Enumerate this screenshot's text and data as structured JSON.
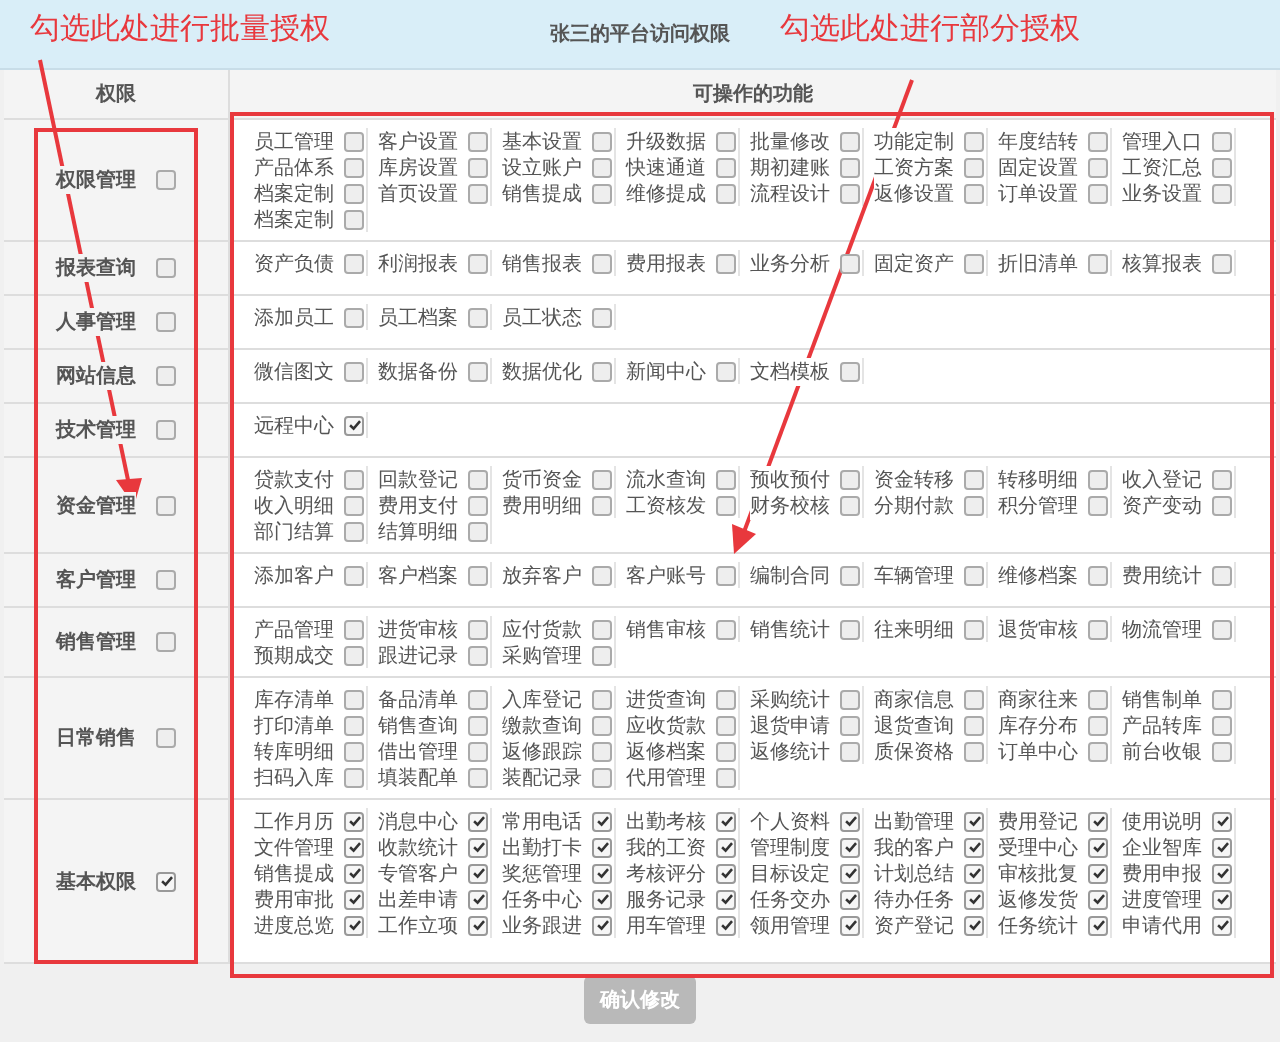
{
  "title": "张三的平台访问权限",
  "columns": [
    "权限",
    "可操作的功能"
  ],
  "annotations": [
    "勾选此处进行批量授权",
    "勾选此处进行部分授权"
  ],
  "groups": [
    {
      "name": "权限管理",
      "checked": false,
      "items": [
        {
          "label": "员工管理",
          "checked": false
        },
        {
          "label": "客户设置",
          "checked": false
        },
        {
          "label": "基本设置",
          "checked": false
        },
        {
          "label": "升级数据",
          "checked": false
        },
        {
          "label": "批量修改",
          "checked": false
        },
        {
          "label": "功能定制",
          "checked": false
        },
        {
          "label": "年度结转",
          "checked": false
        },
        {
          "label": "管理入口",
          "checked": false
        },
        {
          "label": "产品体系",
          "checked": false
        },
        {
          "label": "库房设置",
          "checked": false
        },
        {
          "label": "设立账户",
          "checked": false
        },
        {
          "label": "快速通道",
          "checked": false
        },
        {
          "label": "期初建账",
          "checked": false
        },
        {
          "label": "工资方案",
          "checked": false
        },
        {
          "label": "固定设置",
          "checked": false
        },
        {
          "label": "工资汇总",
          "checked": false
        },
        {
          "label": "档案定制",
          "checked": false
        },
        {
          "label": "首页设置",
          "checked": false
        },
        {
          "label": "销售提成",
          "checked": false
        },
        {
          "label": "维修提成",
          "checked": false
        },
        {
          "label": "流程设计",
          "checked": false
        },
        {
          "label": "返修设置",
          "checked": false
        },
        {
          "label": "订单设置",
          "checked": false
        },
        {
          "label": "业务设置",
          "checked": false
        },
        {
          "label": "档案定制",
          "checked": false
        }
      ]
    },
    {
      "name": "报表查询",
      "checked": false,
      "items": [
        {
          "label": "资产负债",
          "checked": false
        },
        {
          "label": "利润报表",
          "checked": false
        },
        {
          "label": "销售报表",
          "checked": false
        },
        {
          "label": "费用报表",
          "checked": false
        },
        {
          "label": "业务分析",
          "checked": false
        },
        {
          "label": "固定资产",
          "checked": false
        },
        {
          "label": "折旧清单",
          "checked": false
        },
        {
          "label": "核算报表",
          "checked": false
        }
      ]
    },
    {
      "name": "人事管理",
      "checked": false,
      "items": [
        {
          "label": "添加员工",
          "checked": false
        },
        {
          "label": "员工档案",
          "checked": false
        },
        {
          "label": "员工状态",
          "checked": false
        }
      ]
    },
    {
      "name": "网站信息",
      "checked": false,
      "items": [
        {
          "label": "微信图文",
          "checked": false
        },
        {
          "label": "数据备份",
          "checked": false
        },
        {
          "label": "数据优化",
          "checked": false
        },
        {
          "label": "新闻中心",
          "checked": false
        },
        {
          "label": "文档模板",
          "checked": false
        }
      ]
    },
    {
      "name": "技术管理",
      "checked": false,
      "items": [
        {
          "label": "远程中心",
          "checked": true
        }
      ]
    },
    {
      "name": "资金管理",
      "checked": false,
      "items": [
        {
          "label": "贷款支付",
          "checked": false
        },
        {
          "label": "回款登记",
          "checked": false
        },
        {
          "label": "货币资金",
          "checked": false
        },
        {
          "label": "流水查询",
          "checked": false
        },
        {
          "label": "预收预付",
          "checked": false
        },
        {
          "label": "资金转移",
          "checked": false
        },
        {
          "label": "转移明细",
          "checked": false
        },
        {
          "label": "收入登记",
          "checked": false
        },
        {
          "label": "收入明细",
          "checked": false
        },
        {
          "label": "费用支付",
          "checked": false
        },
        {
          "label": "费用明细",
          "checked": false
        },
        {
          "label": "工资核发",
          "checked": false
        },
        {
          "label": "财务校核",
          "checked": false
        },
        {
          "label": "分期付款",
          "checked": false
        },
        {
          "label": "积分管理",
          "checked": false
        },
        {
          "label": "资产变动",
          "checked": false
        },
        {
          "label": "部门结算",
          "checked": false
        },
        {
          "label": "结算明细",
          "checked": false
        }
      ]
    },
    {
      "name": "客户管理",
      "checked": false,
      "items": [
        {
          "label": "添加客户",
          "checked": false
        },
        {
          "label": "客户档案",
          "checked": false
        },
        {
          "label": "放弃客户",
          "checked": false
        },
        {
          "label": "客户账号",
          "checked": false
        },
        {
          "label": "编制合同",
          "checked": false
        },
        {
          "label": "车辆管理",
          "checked": false
        },
        {
          "label": "维修档案",
          "checked": false
        },
        {
          "label": "费用统计",
          "checked": false
        }
      ]
    },
    {
      "name": "销售管理",
      "checked": false,
      "items": [
        {
          "label": "产品管理",
          "checked": false
        },
        {
          "label": "进货审核",
          "checked": false
        },
        {
          "label": "应付货款",
          "checked": false
        },
        {
          "label": "销售审核",
          "checked": false
        },
        {
          "label": "销售统计",
          "checked": false
        },
        {
          "label": "往来明细",
          "checked": false
        },
        {
          "label": "退货审核",
          "checked": false
        },
        {
          "label": "物流管理",
          "checked": false
        },
        {
          "label": "预期成交",
          "checked": false
        },
        {
          "label": "跟进记录",
          "checked": false
        },
        {
          "label": "采购管理",
          "checked": false
        }
      ]
    },
    {
      "name": "日常销售",
      "checked": false,
      "items": [
        {
          "label": "库存清单",
          "checked": false
        },
        {
          "label": "备品清单",
          "checked": false
        },
        {
          "label": "入库登记",
          "checked": false
        },
        {
          "label": "进货查询",
          "checked": false
        },
        {
          "label": "采购统计",
          "checked": false
        },
        {
          "label": "商家信息",
          "checked": false
        },
        {
          "label": "商家往来",
          "checked": false
        },
        {
          "label": "销售制单",
          "checked": false
        },
        {
          "label": "打印清单",
          "checked": false
        },
        {
          "label": "销售查询",
          "checked": false
        },
        {
          "label": "缴款查询",
          "checked": false
        },
        {
          "label": "应收货款",
          "checked": false
        },
        {
          "label": "退货申请",
          "checked": false
        },
        {
          "label": "退货查询",
          "checked": false
        },
        {
          "label": "库存分布",
          "checked": false
        },
        {
          "label": "产品转库",
          "checked": false
        },
        {
          "label": "转库明细",
          "checked": false
        },
        {
          "label": "借出管理",
          "checked": false
        },
        {
          "label": "返修跟踪",
          "checked": false
        },
        {
          "label": "返修档案",
          "checked": false
        },
        {
          "label": "返修统计",
          "checked": false
        },
        {
          "label": "质保资格",
          "checked": false
        },
        {
          "label": "订单中心",
          "checked": false
        },
        {
          "label": "前台收银",
          "checked": false
        },
        {
          "label": "扫码入库",
          "checked": false
        },
        {
          "label": "填装配单",
          "checked": false
        },
        {
          "label": "装配记录",
          "checked": false
        },
        {
          "label": "代用管理",
          "checked": false
        }
      ]
    },
    {
      "name": "基本权限",
      "checked": true,
      "items": [
        {
          "label": "工作月历",
          "checked": true
        },
        {
          "label": "消息中心",
          "checked": true
        },
        {
          "label": "常用电话",
          "checked": true
        },
        {
          "label": "出勤考核",
          "checked": true
        },
        {
          "label": "个人资料",
          "checked": true
        },
        {
          "label": "出勤管理",
          "checked": true
        },
        {
          "label": "费用登记",
          "checked": true
        },
        {
          "label": "使用说明",
          "checked": true
        },
        {
          "label": "文件管理",
          "checked": true
        },
        {
          "label": "收款统计",
          "checked": true
        },
        {
          "label": "出勤打卡",
          "checked": true
        },
        {
          "label": "我的工资",
          "checked": true
        },
        {
          "label": "管理制度",
          "checked": true
        },
        {
          "label": "我的客户",
          "checked": true
        },
        {
          "label": "受理中心",
          "checked": true
        },
        {
          "label": "企业智库",
          "checked": true
        },
        {
          "label": "销售提成",
          "checked": true
        },
        {
          "label": "专管客户",
          "checked": true
        },
        {
          "label": "奖惩管理",
          "checked": true
        },
        {
          "label": "考核评分",
          "checked": true
        },
        {
          "label": "目标设定",
          "checked": true
        },
        {
          "label": "计划总结",
          "checked": true
        },
        {
          "label": "审核批复",
          "checked": true
        },
        {
          "label": "费用申报",
          "checked": true
        },
        {
          "label": "费用审批",
          "checked": true
        },
        {
          "label": "出差申请",
          "checked": true
        },
        {
          "label": "任务中心",
          "checked": true
        },
        {
          "label": "服务记录",
          "checked": true
        },
        {
          "label": "任务交办",
          "checked": true
        },
        {
          "label": "待办任务",
          "checked": true
        },
        {
          "label": "返修发货",
          "checked": true
        },
        {
          "label": "进度管理",
          "checked": true
        },
        {
          "label": "进度总览",
          "checked": true
        },
        {
          "label": "工作立项",
          "checked": true
        },
        {
          "label": "业务跟进",
          "checked": true
        },
        {
          "label": "用车管理",
          "checked": true
        },
        {
          "label": "领用管理",
          "checked": true
        },
        {
          "label": "资产登记",
          "checked": true
        },
        {
          "label": "任务统计",
          "checked": true
        },
        {
          "label": "申请代用",
          "checked": true
        }
      ]
    }
  ],
  "button": "确认修改"
}
